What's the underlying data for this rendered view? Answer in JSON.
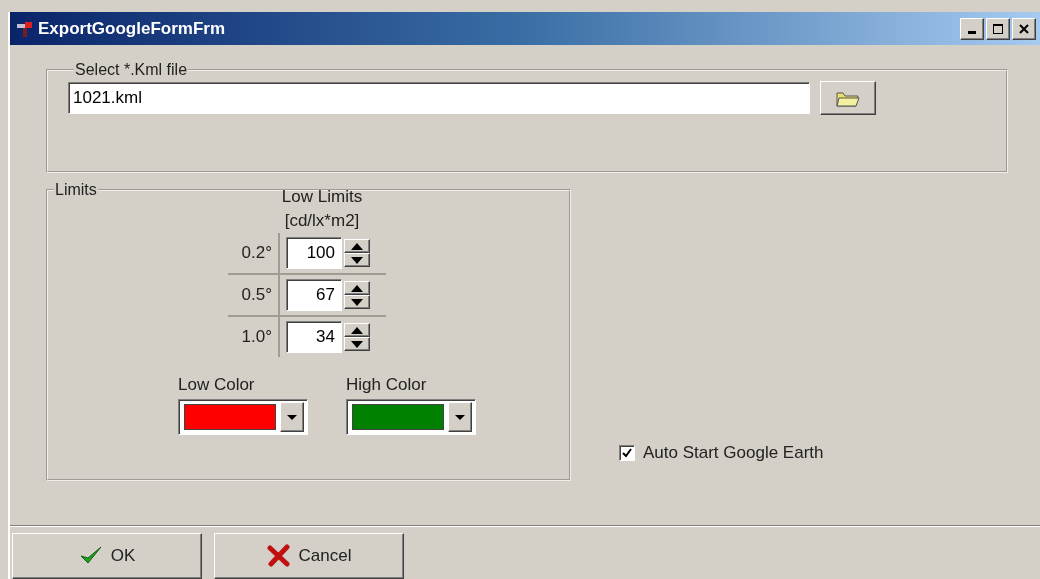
{
  "window": {
    "title": "ExportGoogleFormFrm"
  },
  "file_group": {
    "legend": "Select *.Kml file",
    "value": "1021.kml"
  },
  "limits": {
    "legend": "Limits",
    "heading": "Low Limits",
    "unit": "[cd/lx*m2]",
    "rows": [
      {
        "label": "0.2°",
        "value": "100"
      },
      {
        "label": "0.5°",
        "value": "67"
      },
      {
        "label": "1.0°",
        "value": "34"
      }
    ],
    "colors": [
      {
        "label": "Low Color",
        "color": "#ff0000"
      },
      {
        "label": "High Color",
        "color": "#008000"
      }
    ]
  },
  "auto_start": {
    "label": "Auto Start Google Earth",
    "checked": true
  },
  "buttons": [
    {
      "label": "OK",
      "kind": "ok"
    },
    {
      "label": "Cancel",
      "kind": "cancel"
    }
  ]
}
